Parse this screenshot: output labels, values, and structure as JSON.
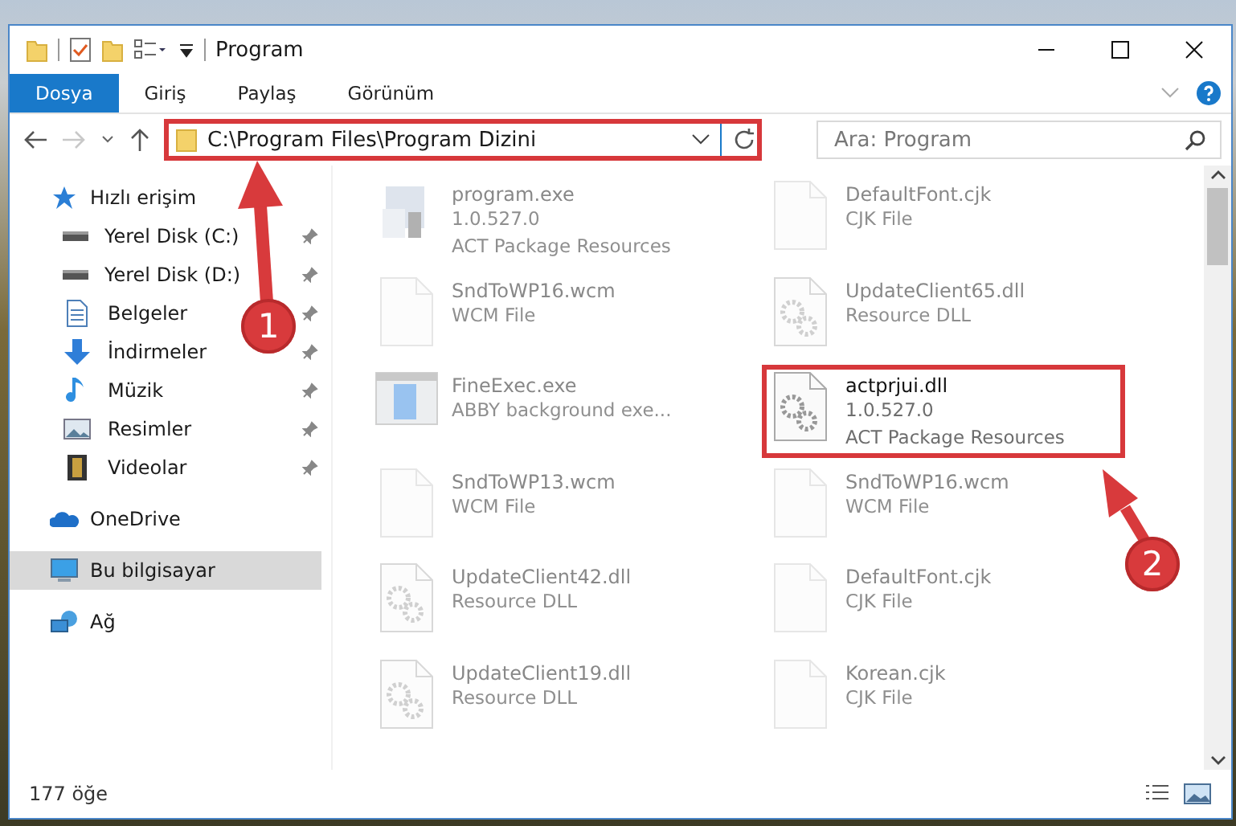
{
  "window": {
    "title": "Program"
  },
  "ribbon": {
    "tabs": [
      {
        "label": "Dosya",
        "selected": true
      },
      {
        "label": "Giriş",
        "selected": false
      },
      {
        "label": "Paylaş",
        "selected": false
      },
      {
        "label": "Görünüm",
        "selected": false
      }
    ]
  },
  "address": {
    "path": "C:\\Program Files\\Program Dizini",
    "highlighted": true
  },
  "search": {
    "placeholder": "Ara: Program"
  },
  "sidebar": {
    "groups": [
      {
        "label": "Hızlı erişim",
        "selected": false,
        "children": [
          {
            "label": "Yerel Disk (C:)",
            "pinned": true,
            "selected": false
          },
          {
            "label": "Yerel Disk (D:)",
            "pinned": true,
            "selected": false
          },
          {
            "label": "Belgeler",
            "pinned": true,
            "selected": false
          },
          {
            "label": "İndirmeler",
            "pinned": true,
            "selected": false
          },
          {
            "label": "Müzik",
            "pinned": true,
            "selected": false
          },
          {
            "label": "Resimler",
            "pinned": true,
            "selected": false
          },
          {
            "label": "Videolar",
            "pinned": true,
            "selected": false
          }
        ]
      },
      {
        "label": "OneDrive",
        "selected": false
      },
      {
        "label": "Bu bilgisayar",
        "selected": true
      },
      {
        "label": "Ağ",
        "selected": false
      }
    ]
  },
  "files": [
    {
      "name": "program.exe",
      "lines": [
        "1.0.527.0",
        "ACT Package Resources"
      ],
      "highlighted": false
    },
    {
      "name": "DefaultFont.cjk",
      "lines": [
        "CJK File"
      ],
      "highlighted": false
    },
    {
      "name": "SndToWP16.wcm",
      "lines": [
        "WCM File"
      ],
      "highlighted": false
    },
    {
      "name": "UpdateClient65.dll",
      "lines": [
        "Resource DLL"
      ],
      "highlighted": false
    },
    {
      "name": "FineExec.exe",
      "lines": [
        "ABBY background exe..."
      ],
      "highlighted": false
    },
    {
      "name": "actprjui.dll",
      "lines": [
        "1.0.527.0",
        "ACT Package Resources"
      ],
      "highlighted": true
    },
    {
      "name": "SndToWP13.wcm",
      "lines": [
        "WCM File"
      ],
      "highlighted": false
    },
    {
      "name": "SndToWP16.wcm",
      "lines": [
        "WCM File"
      ],
      "highlighted": false
    },
    {
      "name": "UpdateClient42.dll",
      "lines": [
        "Resource DLL"
      ],
      "highlighted": false
    },
    {
      "name": "DefaultFont.cjk",
      "lines": [
        "CJK File"
      ],
      "highlighted": false
    },
    {
      "name": "UpdateClient19.dll",
      "lines": [
        "Resource DLL"
      ],
      "highlighted": false
    },
    {
      "name": "Korean.cjk",
      "lines": [
        "CJK File"
      ],
      "highlighted": false
    }
  ],
  "status_bar": {
    "count": "177 öğe"
  },
  "annotations": [
    {
      "number": "1"
    },
    {
      "number": "2"
    }
  ]
}
